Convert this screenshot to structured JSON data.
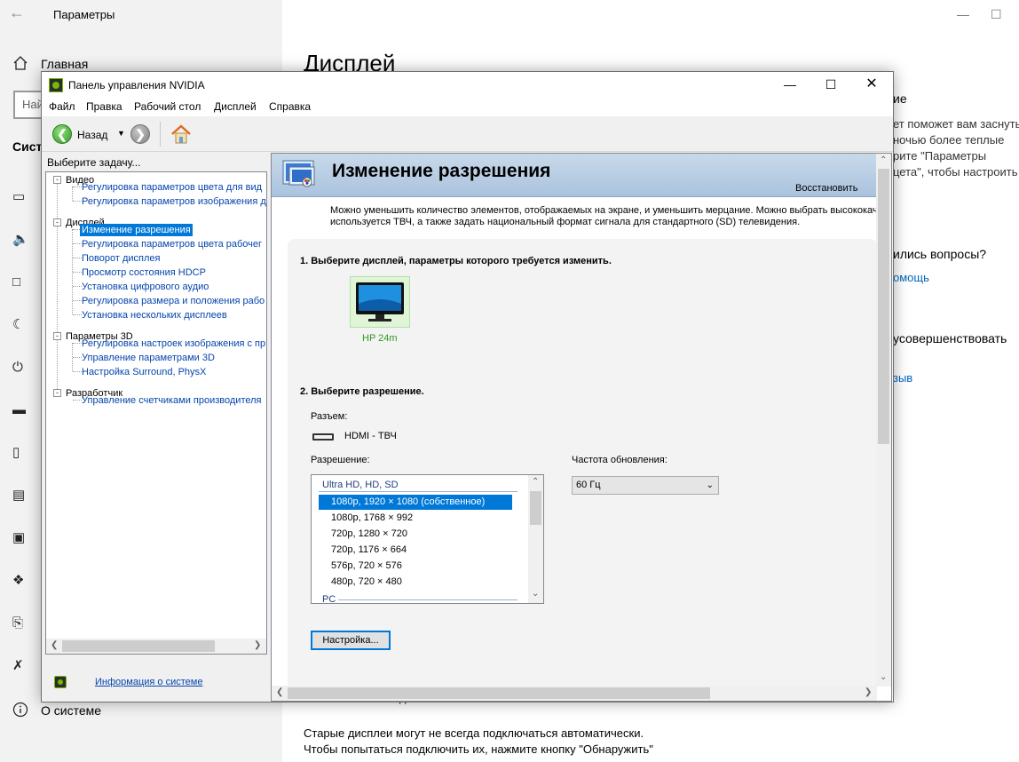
{
  "settings": {
    "window_title": "Параметры",
    "home_label": "Главная",
    "search_placeholder": "Найти параметр",
    "section": "Система",
    "page_heading": "Дисплей",
    "about_label": "О системе",
    "right_panel": {
      "line1": "ие",
      "line2": "ет поможет вам заснуть",
      "line3": "ночью более теплые",
      "line4": "рите \"Параметры",
      "line5": "цета\", чтобы настроить",
      "question": "ились вопросы?",
      "help_link": "омощь",
      "improve": "усовершенствовать",
      "feedback_link": "зыв"
    },
    "bottom_text1": "Старые дисплеи могут не всегда подключаться автоматически.",
    "bottom_text2": "Чтобы попытаться подключить их, нажмите кнопку \"Обнаружить\"",
    "partial_text": "д"
  },
  "nvidia": {
    "title": "Панель управления NVIDIA",
    "menu": [
      "Файл",
      "Правка",
      "Рабочий стол",
      "Дисплей",
      "Справка"
    ],
    "toolbar": {
      "back_label": "Назад"
    },
    "task_label": "Выберите задачу...",
    "tree": {
      "video": "Видео",
      "video_items": [
        "Регулировка параметров цвета для вид",
        "Регулировка параметров изображения д"
      ],
      "display": "Дисплей",
      "display_items": [
        "Изменение разрешения",
        "Регулировка параметров цвета рабочег",
        "Поворот дисплея",
        "Просмотр состояния HDCP",
        "Установка цифрового аудио",
        "Регулировка размера и положения рабо",
        "Установка нескольких дисплеев"
      ],
      "p3d": "Параметры 3D",
      "p3d_items": [
        "Регулировка настроек изображения с пр",
        "Управление параметрами 3D",
        "Настройка Surround, PhysX"
      ],
      "dev": "Разработчик",
      "dev_items": [
        "Управление счетчиками производителя"
      ]
    },
    "sysinfo_link": "Информация о системе",
    "content": {
      "title": "Изменение разрешения",
      "restore": "Восстановить",
      "desc1": "Можно уменьшить количество элементов, отображаемых на экране, и уменьшить мерцание. Можно выбрать высококачественный",
      "desc2": "используется ТВЧ, а также задать национальный формат сигнала для стандартного (SD) телевидения.",
      "step1": "1. Выберите дисплей, параметры которого требуется изменить.",
      "monitor_name": "HP 24m",
      "step2": "2. Выберите разрешение.",
      "connector_label": "Разъем:",
      "connector_value": "HDMI - ТВЧ",
      "resolution_label": "Разрешение:",
      "refresh_label": "Частота обновления:",
      "refresh_value": "60 Гц",
      "group_hd": "Ultra HD, HD, SD",
      "group_pc": "PC",
      "resolutions": [
        "1080p, 1920 × 1080 (собственное)",
        "1080p, 1768 × 992",
        "720p, 1280 × 720",
        "720p, 1176 × 664",
        "576p, 720 × 576",
        "480p, 720 × 480"
      ],
      "setup_button": "Настройка..."
    }
  },
  "colors": {
    "accent": "#0078d7",
    "nvidia_green": "#76b900",
    "link": "#0645ad"
  }
}
